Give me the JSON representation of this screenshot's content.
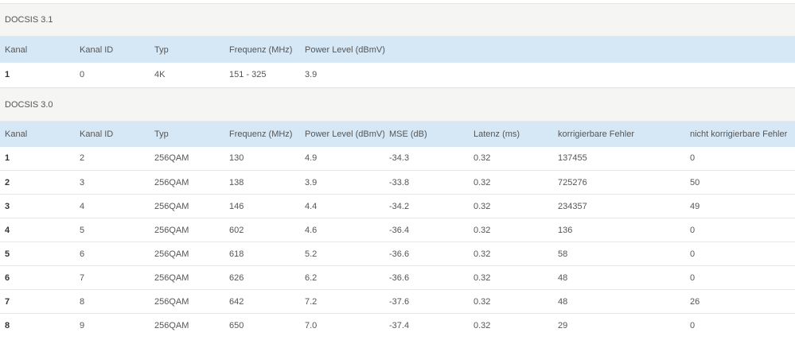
{
  "docsis31": {
    "title": "DOCSIS 3.1",
    "columns": [
      "Kanal",
      "Kanal ID",
      "Typ",
      "Frequenz (MHz)",
      "Power Level (dBmV)"
    ],
    "rows": [
      [
        "1",
        "0",
        "4K",
        "151 - 325",
        "3.9"
      ]
    ]
  },
  "docsis30": {
    "title": "DOCSIS 3.0",
    "columns": [
      "Kanal",
      "Kanal ID",
      "Typ",
      "Frequenz (MHz)",
      "Power Level (dBmV)",
      "MSE (dB)",
      "Latenz (ms)",
      "korrigierbare Fehler",
      "nicht korrigierbare Fehler"
    ],
    "rows": [
      [
        "1",
        "2",
        "256QAM",
        "130",
        "4.9",
        "-34.3",
        "0.32",
        "137455",
        "0"
      ],
      [
        "2",
        "3",
        "256QAM",
        "138",
        "3.9",
        "-33.8",
        "0.32",
        "725276",
        "50"
      ],
      [
        "3",
        "4",
        "256QAM",
        "146",
        "4.4",
        "-34.2",
        "0.32",
        "234357",
        "49"
      ],
      [
        "4",
        "5",
        "256QAM",
        "602",
        "4.6",
        "-36.4",
        "0.32",
        "136",
        "0"
      ],
      [
        "5",
        "6",
        "256QAM",
        "618",
        "5.2",
        "-36.6",
        "0.32",
        "58",
        "0"
      ],
      [
        "6",
        "7",
        "256QAM",
        "626",
        "6.2",
        "-36.6",
        "0.32",
        "48",
        "0"
      ],
      [
        "7",
        "8",
        "256QAM",
        "642",
        "7.2",
        "-37.6",
        "0.32",
        "48",
        "26"
      ],
      [
        "8",
        "9",
        "256QAM",
        "650",
        "7.0",
        "-37.4",
        "0.32",
        "29",
        "0"
      ]
    ]
  }
}
